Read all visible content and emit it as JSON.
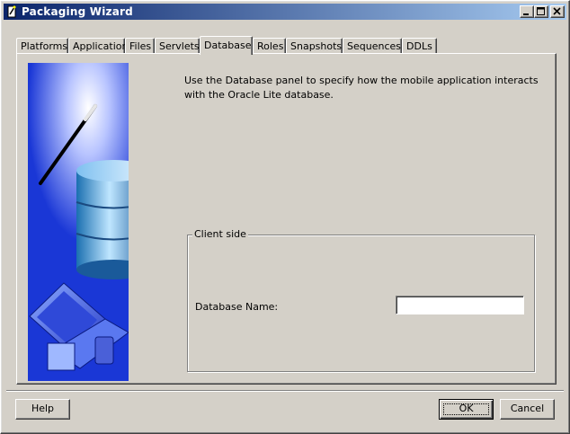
{
  "window": {
    "title": "Packaging Wizard",
    "controls": [
      "minimize",
      "maximize",
      "close"
    ]
  },
  "tabs": [
    {
      "label": "Platforms"
    },
    {
      "label": "Application"
    },
    {
      "label": "Files"
    },
    {
      "label": "Servlets"
    },
    {
      "label": "Database",
      "active": true
    },
    {
      "label": "Roles"
    },
    {
      "label": "Snapshots"
    },
    {
      "label": "Sequences"
    },
    {
      "label": "DDLs"
    }
  ],
  "panel": {
    "description": "Use the Database panel to specify how the mobile application interacts with the Oracle Lite database.",
    "client_side": {
      "group_label": "Client side",
      "database_name_label": "Database Name:",
      "database_name_value": ""
    }
  },
  "buttons": {
    "help": "Help",
    "ok": "OK",
    "cancel": "Cancel"
  },
  "icons": {
    "art": "database-wizard-illustration",
    "app": "wizard-app-icon"
  },
  "colors": {
    "title_bar_start": "#0a246a",
    "title_bar_end": "#a6caf0",
    "art_blue": "#1a37d6"
  }
}
